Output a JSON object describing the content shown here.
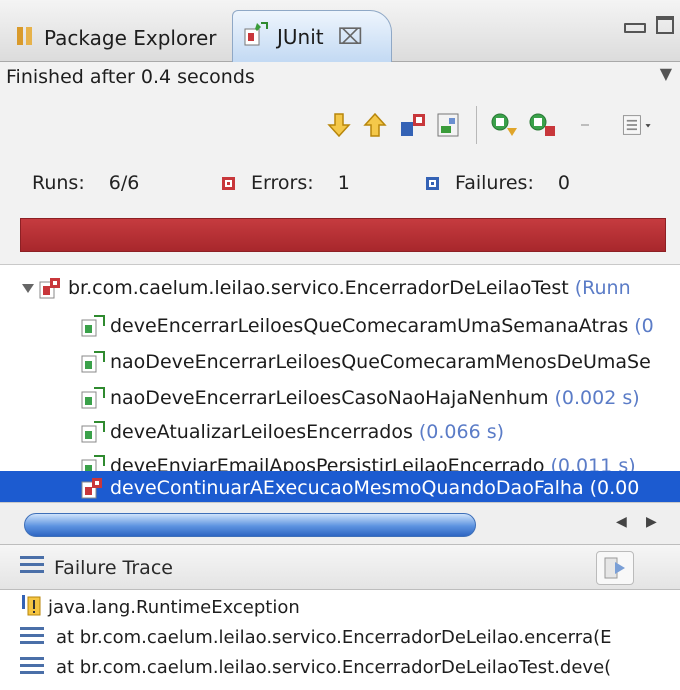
{
  "tabs": {
    "package_explorer": "Package Explorer",
    "junit": "JUnit",
    "close_glyph": "⌧"
  },
  "status": {
    "text": "Finished after 0.4 seconds"
  },
  "counters": {
    "runs_label": "Runs:",
    "runs_value": "6/6",
    "errors_label": "Errors:",
    "errors_value": "1",
    "failures_label": "Failures:",
    "failures_value": "0"
  },
  "progress": {
    "fraction": 1.0,
    "color": "#b7343a",
    "state": "error"
  },
  "tree": {
    "root": {
      "name": "br.com.caelum.leilao.servico.EncerradorDeLeilaoTest",
      "time": "(Runn"
    },
    "items": [
      {
        "name": "deveEncerrarLeiloesQueComecaramUmaSemanaAtras",
        "time": "(0",
        "status": "pass"
      },
      {
        "name": "naoDeveEncerrarLeiloesQueComecaramMenosDeUmaSe",
        "time": "",
        "status": "pass"
      },
      {
        "name": "naoDeveEncerrarLeiloesCasoNaoHajaNenhum",
        "time": "(0.002 s)",
        "status": "pass"
      },
      {
        "name": "deveAtualizarLeiloesEncerrados",
        "time": "(0.066 s)",
        "status": "pass"
      },
      {
        "name": "deveEnviarEmailAposPersistirLeilaoEncerrado",
        "time": "(0.011 s)",
        "status": "pass"
      },
      {
        "name": "deveContinuarAExecucaoMesmoQuandoDaoFalha",
        "time": "(0.00",
        "status": "error"
      }
    ]
  },
  "scroll": {
    "position": 0.0
  },
  "trace": {
    "title": "Failure Trace",
    "lines": [
      "java.lang.RuntimeException",
      "at br.com.caelum.leilao.servico.EncerradorDeLeilao.encerra(E",
      "at br.com.caelum.leilao.servico.EncerradorDeLeilaoTest.deve("
    ]
  },
  "colors": {
    "selection": "#1c5bd0",
    "error": "#b7343a",
    "timing": "#5b7cc7",
    "tab_active": "#c2d9f3"
  }
}
